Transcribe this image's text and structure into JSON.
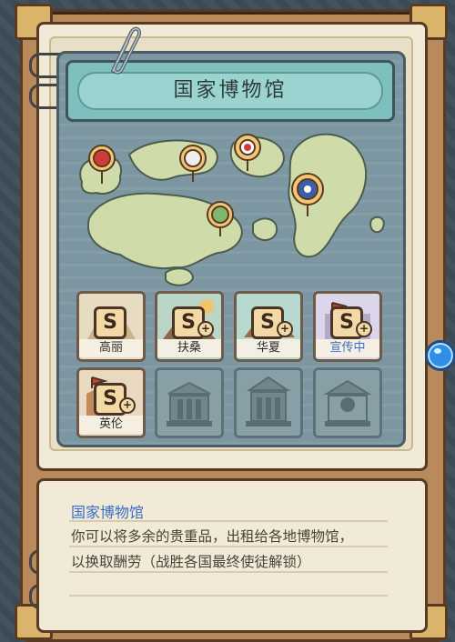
{
  "museum": {
    "title": "国家博物馆",
    "slots": [
      {
        "label": "高丽",
        "grade": "S",
        "plus": false,
        "state": "active"
      },
      {
        "label": "扶桑",
        "grade": "S",
        "plus": true,
        "state": "active"
      },
      {
        "label": "华夏",
        "grade": "S",
        "plus": true,
        "state": "active"
      },
      {
        "label": "宣传中",
        "grade": "S",
        "plus": true,
        "state": "promoting"
      },
      {
        "label": "英伦",
        "grade": "S",
        "plus": true,
        "state": "active"
      },
      {
        "label": "",
        "grade": "",
        "plus": false,
        "state": "locked"
      },
      {
        "label": "",
        "grade": "",
        "plus": false,
        "state": "locked"
      },
      {
        "label": "",
        "grade": "",
        "plus": false,
        "state": "locked"
      }
    ]
  },
  "description": {
    "title": "国家博物馆",
    "line1": "你可以将多余的贵重品，出租给各地博物馆，",
    "line2": "以换取酬劳（战胜各国最终使徒解锁）"
  },
  "colors": {
    "accent_blue": "#3a6fc9",
    "banner": "#7ec0bd",
    "book": "#b98a5c",
    "sea": "#7c97a1",
    "land": "#cfdcaa"
  }
}
